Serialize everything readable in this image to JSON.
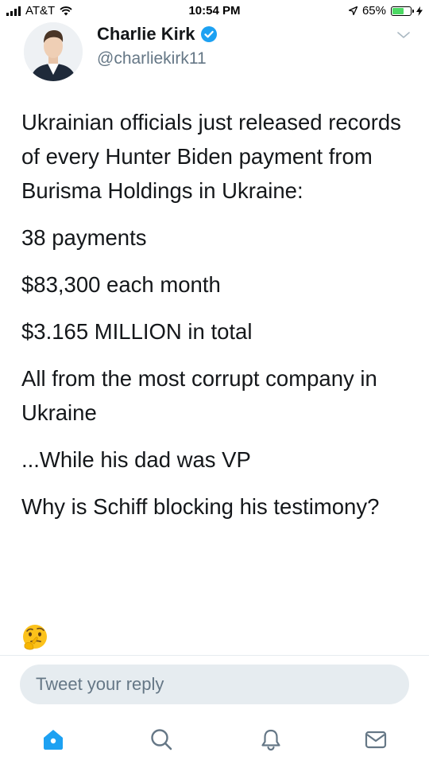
{
  "status_bar": {
    "carrier": "AT&T",
    "time": "10:54 PM",
    "battery_percent": "65%",
    "battery_level": 0.65
  },
  "tweet": {
    "author_name": "Charlie Kirk",
    "author_handle": "@charliekirk11",
    "verified": true,
    "paragraphs": [
      "Ukrainian officials just released records of every Hunter Biden payment from Burisma Holdings in Ukraine:",
      "38 payments",
      "$83,300 each month",
      "$3.165 MILLION in total",
      "All from the most corrupt company in Ukraine",
      "...While his dad was VP",
      "Why is Schiff blocking his testimony?"
    ],
    "emoji": "thinking-face"
  },
  "reply": {
    "placeholder": "Tweet your reply"
  },
  "tabbar": {
    "items": [
      {
        "icon": "home-icon",
        "active": true
      },
      {
        "icon": "search-icon",
        "active": false
      },
      {
        "icon": "notifications-icon",
        "active": false
      },
      {
        "icon": "messages-icon",
        "active": false
      }
    ]
  },
  "colors": {
    "accent": "#1da1f2",
    "text": "#14171a",
    "secondary": "#657786",
    "reply_bg": "#e6ecf0",
    "battery": "#4cd964"
  }
}
